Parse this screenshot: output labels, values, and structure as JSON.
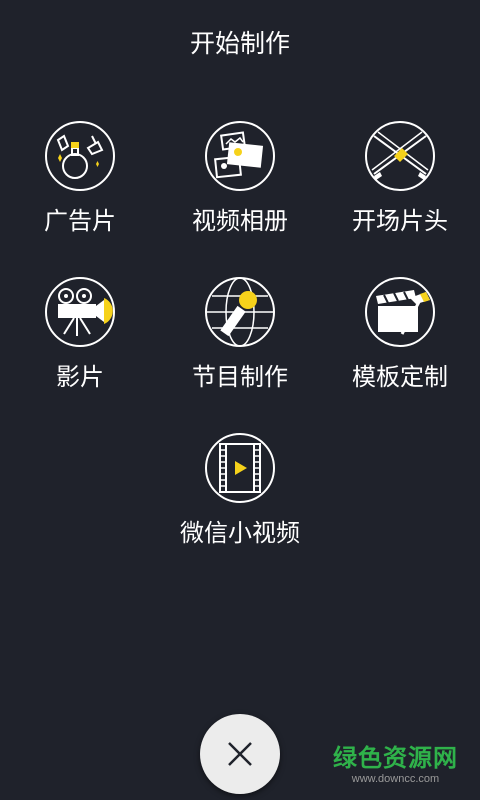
{
  "header": {
    "title": "开始制作"
  },
  "menu": {
    "items": [
      {
        "label": "广告片",
        "icon": "product-ad-icon"
      },
      {
        "label": "视频相册",
        "icon": "photo-album-icon"
      },
      {
        "label": "开场片头",
        "icon": "intro-swords-icon"
      },
      {
        "label": "影片",
        "icon": "movie-camera-icon"
      },
      {
        "label": "节目制作",
        "icon": "microphone-globe-icon"
      },
      {
        "label": "模板定制",
        "icon": "clapperboard-hammer-icon"
      },
      {
        "label": "微信小视频",
        "icon": "film-play-icon"
      }
    ]
  },
  "close_button": {
    "icon": "close-icon"
  },
  "watermark": {
    "text": "绿色资源网",
    "url": "www.downcc.com"
  },
  "colors": {
    "background": "#1f222b",
    "accent": "#f6d21b",
    "icon_stroke": "#ffffff",
    "close_button_bg": "#ececec",
    "watermark_green": "#2fb24a"
  }
}
